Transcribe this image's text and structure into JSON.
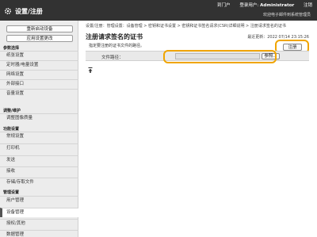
{
  "header": {
    "app_title": "设置/注册",
    "portal_link": "到门户",
    "login_user_label": "登录用户:",
    "login_user_name": "Administrator",
    "logout_link": "注销",
    "welcome": "欢迎电子邮件到系统管理员"
  },
  "sidebar": {
    "restart_button": "重新启动设备",
    "apply_button": "应用设置更改",
    "sections": [
      {
        "title": "参数选择",
        "items": [
          "纸张设置",
          "定时器/电量设置",
          "网络设置",
          "外部接口",
          "音量设置"
        ]
      },
      {
        "title": "调整/维护",
        "items": [
          "调整图像质量"
        ]
      },
      {
        "title": "功能设置",
        "items": [
          "常规设置",
          "打印机",
          "发送",
          "接收",
          "存储/存取文件"
        ]
      },
      {
        "title": "管理设置",
        "items": [
          "用户管理",
          "设备管理",
          "授权/其他",
          "数据管理"
        ]
      }
    ],
    "active_item": "设备管理"
  },
  "main": {
    "breadcrumb": "设置/注册：管理设置：设备管理 > 密钥和证书设置 > 密钥和证书签名请求(CSR)详细说明 > 注册请求签名的证书",
    "title": "注册请求签名的证书",
    "last_updated_label": "最近更新：",
    "last_updated_value": "2022 07/14 23:15:26",
    "register_button": "注册",
    "description": "指定要注册的证书文件的路径。",
    "file_path_label": "文件路径：",
    "file_path_value": "",
    "browse_button": "参照...",
    "to_top_icon": "to-top-arrow-icon"
  },
  "colors": {
    "topbar": "#323232",
    "sidebar": "#ececec",
    "highlight": "#f0a500"
  }
}
